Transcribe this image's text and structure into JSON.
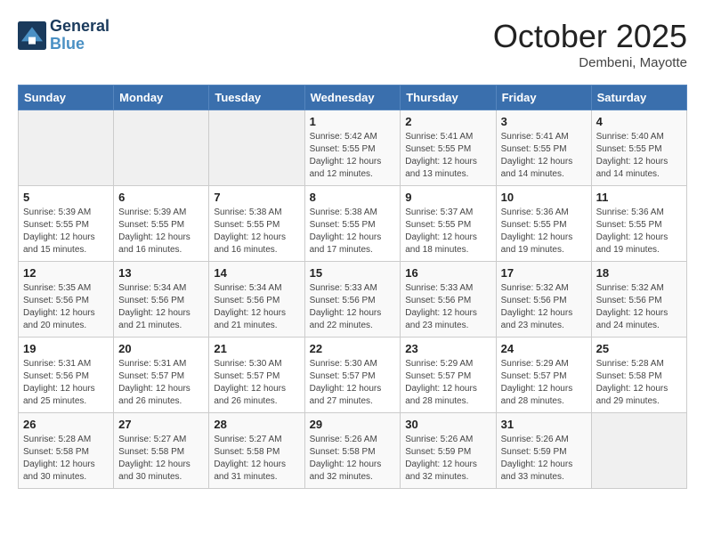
{
  "header": {
    "logo_line1": "General",
    "logo_line2": "Blue",
    "month": "October 2025",
    "location": "Dembeni, Mayotte"
  },
  "weekdays": [
    "Sunday",
    "Monday",
    "Tuesday",
    "Wednesday",
    "Thursday",
    "Friday",
    "Saturday"
  ],
  "weeks": [
    [
      {
        "day": "",
        "info": ""
      },
      {
        "day": "",
        "info": ""
      },
      {
        "day": "",
        "info": ""
      },
      {
        "day": "1",
        "info": "Sunrise: 5:42 AM\nSunset: 5:55 PM\nDaylight: 12 hours\nand 12 minutes."
      },
      {
        "day": "2",
        "info": "Sunrise: 5:41 AM\nSunset: 5:55 PM\nDaylight: 12 hours\nand 13 minutes."
      },
      {
        "day": "3",
        "info": "Sunrise: 5:41 AM\nSunset: 5:55 PM\nDaylight: 12 hours\nand 14 minutes."
      },
      {
        "day": "4",
        "info": "Sunrise: 5:40 AM\nSunset: 5:55 PM\nDaylight: 12 hours\nand 14 minutes."
      }
    ],
    [
      {
        "day": "5",
        "info": "Sunrise: 5:39 AM\nSunset: 5:55 PM\nDaylight: 12 hours\nand 15 minutes."
      },
      {
        "day": "6",
        "info": "Sunrise: 5:39 AM\nSunset: 5:55 PM\nDaylight: 12 hours\nand 16 minutes."
      },
      {
        "day": "7",
        "info": "Sunrise: 5:38 AM\nSunset: 5:55 PM\nDaylight: 12 hours\nand 16 minutes."
      },
      {
        "day": "8",
        "info": "Sunrise: 5:38 AM\nSunset: 5:55 PM\nDaylight: 12 hours\nand 17 minutes."
      },
      {
        "day": "9",
        "info": "Sunrise: 5:37 AM\nSunset: 5:55 PM\nDaylight: 12 hours\nand 18 minutes."
      },
      {
        "day": "10",
        "info": "Sunrise: 5:36 AM\nSunset: 5:55 PM\nDaylight: 12 hours\nand 19 minutes."
      },
      {
        "day": "11",
        "info": "Sunrise: 5:36 AM\nSunset: 5:55 PM\nDaylight: 12 hours\nand 19 minutes."
      }
    ],
    [
      {
        "day": "12",
        "info": "Sunrise: 5:35 AM\nSunset: 5:56 PM\nDaylight: 12 hours\nand 20 minutes."
      },
      {
        "day": "13",
        "info": "Sunrise: 5:34 AM\nSunset: 5:56 PM\nDaylight: 12 hours\nand 21 minutes."
      },
      {
        "day": "14",
        "info": "Sunrise: 5:34 AM\nSunset: 5:56 PM\nDaylight: 12 hours\nand 21 minutes."
      },
      {
        "day": "15",
        "info": "Sunrise: 5:33 AM\nSunset: 5:56 PM\nDaylight: 12 hours\nand 22 minutes."
      },
      {
        "day": "16",
        "info": "Sunrise: 5:33 AM\nSunset: 5:56 PM\nDaylight: 12 hours\nand 23 minutes."
      },
      {
        "day": "17",
        "info": "Sunrise: 5:32 AM\nSunset: 5:56 PM\nDaylight: 12 hours\nand 23 minutes."
      },
      {
        "day": "18",
        "info": "Sunrise: 5:32 AM\nSunset: 5:56 PM\nDaylight: 12 hours\nand 24 minutes."
      }
    ],
    [
      {
        "day": "19",
        "info": "Sunrise: 5:31 AM\nSunset: 5:56 PM\nDaylight: 12 hours\nand 25 minutes."
      },
      {
        "day": "20",
        "info": "Sunrise: 5:31 AM\nSunset: 5:57 PM\nDaylight: 12 hours\nand 26 minutes."
      },
      {
        "day": "21",
        "info": "Sunrise: 5:30 AM\nSunset: 5:57 PM\nDaylight: 12 hours\nand 26 minutes."
      },
      {
        "day": "22",
        "info": "Sunrise: 5:30 AM\nSunset: 5:57 PM\nDaylight: 12 hours\nand 27 minutes."
      },
      {
        "day": "23",
        "info": "Sunrise: 5:29 AM\nSunset: 5:57 PM\nDaylight: 12 hours\nand 28 minutes."
      },
      {
        "day": "24",
        "info": "Sunrise: 5:29 AM\nSunset: 5:57 PM\nDaylight: 12 hours\nand 28 minutes."
      },
      {
        "day": "25",
        "info": "Sunrise: 5:28 AM\nSunset: 5:58 PM\nDaylight: 12 hours\nand 29 minutes."
      }
    ],
    [
      {
        "day": "26",
        "info": "Sunrise: 5:28 AM\nSunset: 5:58 PM\nDaylight: 12 hours\nand 30 minutes."
      },
      {
        "day": "27",
        "info": "Sunrise: 5:27 AM\nSunset: 5:58 PM\nDaylight: 12 hours\nand 30 minutes."
      },
      {
        "day": "28",
        "info": "Sunrise: 5:27 AM\nSunset: 5:58 PM\nDaylight: 12 hours\nand 31 minutes."
      },
      {
        "day": "29",
        "info": "Sunrise: 5:26 AM\nSunset: 5:58 PM\nDaylight: 12 hours\nand 32 minutes."
      },
      {
        "day": "30",
        "info": "Sunrise: 5:26 AM\nSunset: 5:59 PM\nDaylight: 12 hours\nand 32 minutes."
      },
      {
        "day": "31",
        "info": "Sunrise: 5:26 AM\nSunset: 5:59 PM\nDaylight: 12 hours\nand 33 minutes."
      },
      {
        "day": "",
        "info": ""
      }
    ]
  ]
}
